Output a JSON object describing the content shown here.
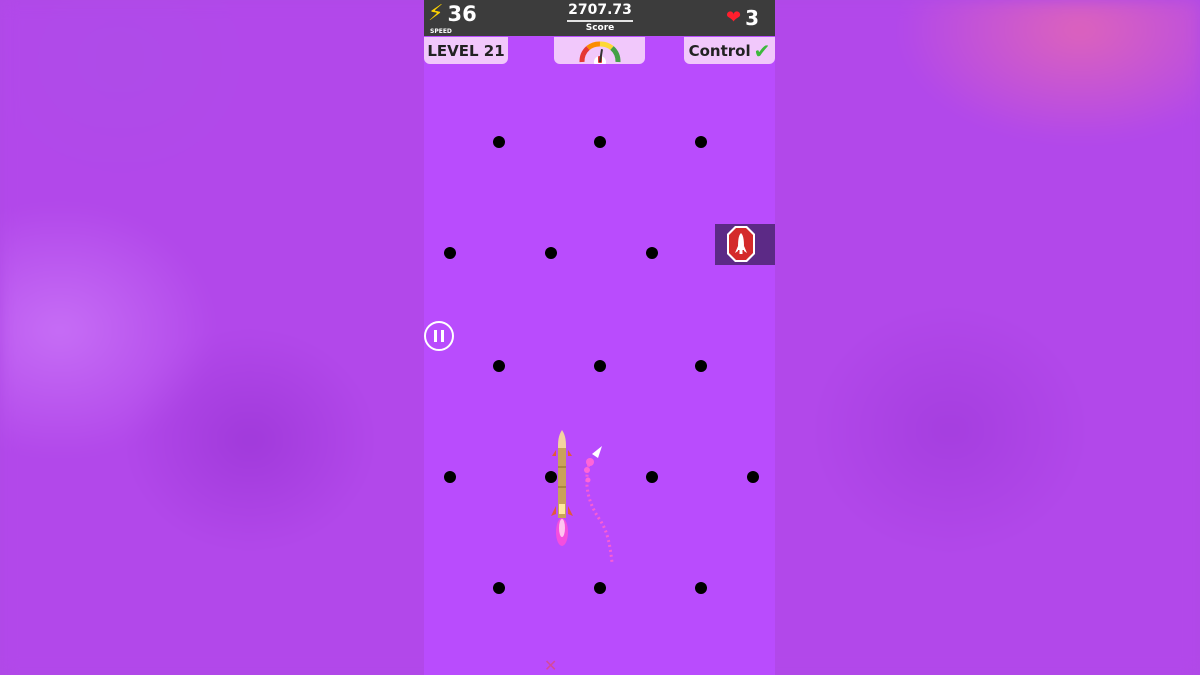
{
  "hud": {
    "speed_value": "36",
    "speed_label": "SPEED",
    "score_value": "2707.73",
    "score_label": "Score",
    "lives_value": "3",
    "level_label": "LEVEL 21",
    "control_label": "Control"
  },
  "icons": {
    "speed": "lightning-bolt",
    "lives": "heart",
    "control": "checkmark",
    "gauge": "speed-gauge",
    "pause": "pause",
    "rocket_button": "rocket-stop-sign",
    "player": "rocket",
    "enemy": "paper-plane-missile",
    "marker": "x-mark"
  },
  "colors": {
    "playfield": "#b94cfd",
    "hud_bar": "#3c3c3c",
    "panel": "#f1c8fb",
    "heart": "#ff1e2d",
    "check": "#3db83d",
    "stop_sign": "#d42a2a"
  },
  "gauge_level": 0.55
}
